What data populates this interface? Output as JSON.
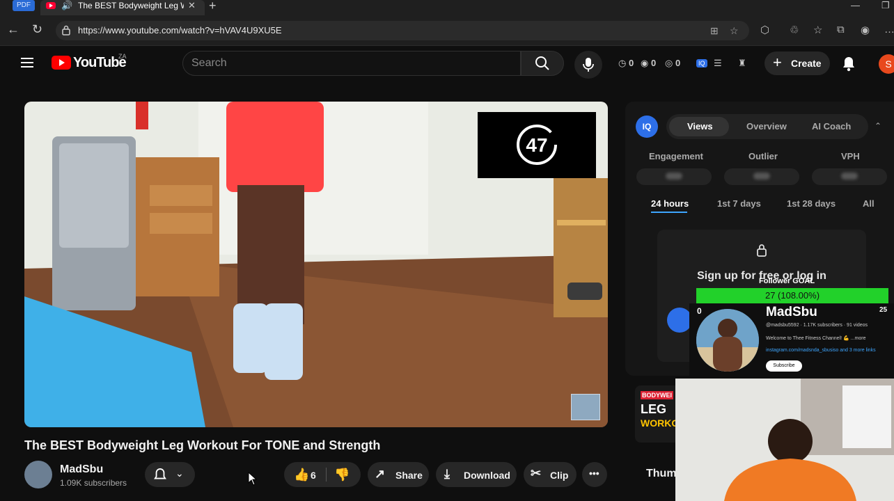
{
  "browser": {
    "pdf_badge": "PDF",
    "tab_title": "The BEST Bodyweight Leg W",
    "url": "https://www.youtube.com/watch?v=hVAV4U9XU5E"
  },
  "header": {
    "logo_text": "YouTube",
    "country_code": "ZA",
    "search_placeholder": "Search",
    "stats": [
      "0",
      "0",
      "0"
    ],
    "create_label": "Create",
    "avatar_letter": "S"
  },
  "player": {
    "overlay_count": "47"
  },
  "video": {
    "title": "The BEST Bodyweight Leg Workout For TONE and Strength",
    "channel": "MadSbu",
    "subscribers": "1.09K subscribers",
    "likes": "6",
    "share_label": "Share",
    "download_label": "Download",
    "clip_label": "Clip"
  },
  "vidiq": {
    "badge": "IQ",
    "tabs": [
      "Views",
      "Overview",
      "AI Coach"
    ],
    "active_tab": "Views",
    "metrics": [
      "Engagement",
      "Outlier",
      "VPH"
    ],
    "ranges": [
      "24 hours",
      "1st 7 days",
      "1st 28 days",
      "All"
    ],
    "active_range": "24 hours",
    "locked_message": "Sign up for free or log in"
  },
  "recommendation": {
    "tag": "BODYWEI",
    "line1": "LEG",
    "line2": "WORKO",
    "title": "Thum"
  },
  "follower_goal": {
    "label": "Follower GOAL",
    "progress_text": "27 (108.00%)",
    "progress_fraction": 1.0,
    "min": "0",
    "max": "25"
  },
  "channel_card": {
    "name": "MadSbu",
    "meta": "@madsbu5592 · 1.17K subscribers · 91 videos",
    "description": "Welcome to Thee Fitness Channel! 💪 ...more",
    "links": "instagram.com/madsnda_sbusiso and 3 more links",
    "subscribe": "Subscribe"
  },
  "colors": {
    "yt_red": "#ff0000",
    "goal_green": "#22d12a",
    "vidiq_blue": "#2d6fe8",
    "active_underline": "#3ea6ff"
  }
}
